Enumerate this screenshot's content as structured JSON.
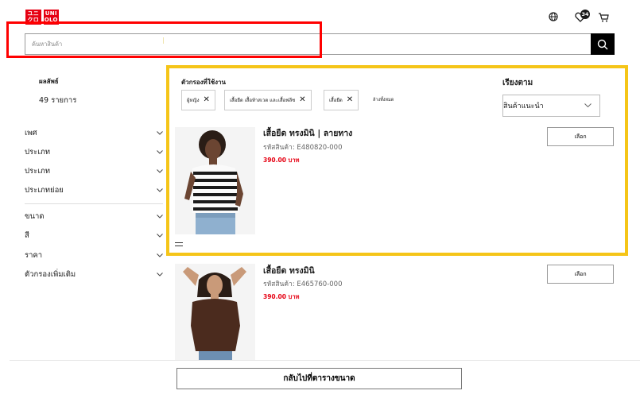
{
  "header": {
    "logo_top": "ユニ",
    "logo_bottom": "クロ",
    "logo_right_top": "UNI",
    "logo_right_bottom": "QLO",
    "wishlist_count": "34",
    "icons": [
      "globe-icon",
      "heart-icon",
      "cart-icon"
    ]
  },
  "search": {
    "placeholder": "ค้นหาสินค้า"
  },
  "sidebar": {
    "results_title": "ผลลัพธ์",
    "results_count": "49 รายการ",
    "facets_group1": [
      "เพศ",
      "ประเภท",
      "ประเภท",
      "ประเภทย่อย"
    ],
    "facets_group2": [
      "ขนาด",
      "สี",
      "ราคา",
      "ตัวกรองเพิ่มเติม"
    ]
  },
  "filters": {
    "label": "ตัวกรองที่ใช้งาน",
    "chips": [
      "ผู้หญิง",
      "เสื้อยืด เสื้อท้าสเวต และเสื้อฟลีซ",
      "เสื้อยืด"
    ],
    "clear_all": "ล้างทั้งหมด"
  },
  "sort": {
    "label": "เรียงตาม",
    "selected": "สินค้าแนะนำ"
  },
  "products": [
    {
      "name": "เสื้อยืด ทรงมินิ | ลายทาง",
      "code": "รหัสสินค้า: E480820-000",
      "price": "390.00 บาท",
      "button": "เลือก"
    },
    {
      "name": "เสื้อยืด ทรงมินิ",
      "code": "รหัสสินค้า: E465760-000",
      "price": "390.00 บาท",
      "button": "เลือก"
    }
  ],
  "footer": {
    "back_button": "กลับไปที่ตารางขนาด"
  },
  "colors": {
    "brand_red": "#e60012",
    "highlight_red": "#ff0000",
    "highlight_yellow": "#f5c518"
  }
}
